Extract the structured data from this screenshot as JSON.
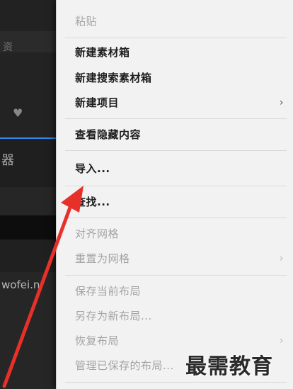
{
  "sidebar": {
    "top_glyph": "资",
    "shield_glyph": "♥",
    "panel_glyph": "器",
    "partial_text": "wofei.n"
  },
  "menu": {
    "items": [
      {
        "label": "粘贴",
        "enabled": false
      },
      {
        "label": "新建素材箱",
        "enabled": true
      },
      {
        "label": "新建搜索素材箱",
        "enabled": true
      },
      {
        "label": "新建项目",
        "enabled": true,
        "submenu": "›"
      },
      {
        "label": "查看隐藏内容",
        "enabled": true
      },
      {
        "label": "导入...",
        "enabled": true
      },
      {
        "label": "查找...",
        "enabled": true
      },
      {
        "label": "对齐网格",
        "enabled": false
      },
      {
        "label": "重置为网格",
        "enabled": false,
        "submenu": "›"
      },
      {
        "label": "保存当前布局",
        "enabled": false
      },
      {
        "label": "另存为新布局...",
        "enabled": false
      },
      {
        "label": "恢复布局",
        "enabled": false,
        "submenu": "›"
      },
      {
        "label": "管理已保存的布局...",
        "enabled": false
      }
    ]
  },
  "annotation": {
    "arrow_color": "#e8302a"
  },
  "watermark": "最需教育"
}
